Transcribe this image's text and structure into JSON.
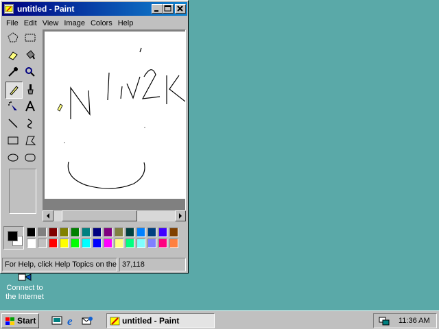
{
  "desktop": {
    "icon_label_line1": "Connect to",
    "icon_label_line2": "the Internet",
    "icon": "connect-internet-icon",
    "background_color": "#5aa9a8"
  },
  "window": {
    "title": "untitled - Paint",
    "title_icon": "paint-app-icon",
    "buttons": [
      "minimize-icon",
      "maximize-icon",
      "close-icon"
    ]
  },
  "menubar": {
    "items": [
      "File",
      "Edit",
      "View",
      "Image",
      "Colors",
      "Help"
    ]
  },
  "tools": [
    "free-select",
    "rect-select",
    "eraser",
    "fill-bucket",
    "color-picker",
    "magnifier",
    "pencil",
    "brush",
    "airbrush",
    "text",
    "line",
    "curve",
    "rectangle",
    "polygon",
    "ellipse",
    "rounded-rect"
  ],
  "active_tool": "pencil",
  "canvas": {
    "drawing": "handwritten 'N liv2k' with a curve below"
  },
  "palette": {
    "foreground": "#000000",
    "background": "#ffffff",
    "row1": [
      "#000000",
      "#808080",
      "#800000",
      "#808000",
      "#008000",
      "#008080",
      "#000080",
      "#800080",
      "#808040",
      "#004040",
      "#0080ff",
      "#004080",
      "#4000ff",
      "#804000"
    ],
    "row2": [
      "#ffffff",
      "#c0c0c0",
      "#ff0000",
      "#ffff00",
      "#00ff00",
      "#00ffff",
      "#0000ff",
      "#ff00ff",
      "#ffff80",
      "#00ff80",
      "#80ffff",
      "#8080ff",
      "#ff0080",
      "#ff8040"
    ]
  },
  "statusbar": {
    "help": "For Help, click Help Topics on the Help Menu.",
    "coords": "37,118"
  },
  "taskbar": {
    "start_label": "Start",
    "quick_launch": [
      "show-desktop-icon",
      "internet-explorer-icon",
      "outlook-express-icon"
    ],
    "task_label": "untitled - Paint",
    "clock": "11:36 AM",
    "tray_icon": "network-tray-icon"
  }
}
